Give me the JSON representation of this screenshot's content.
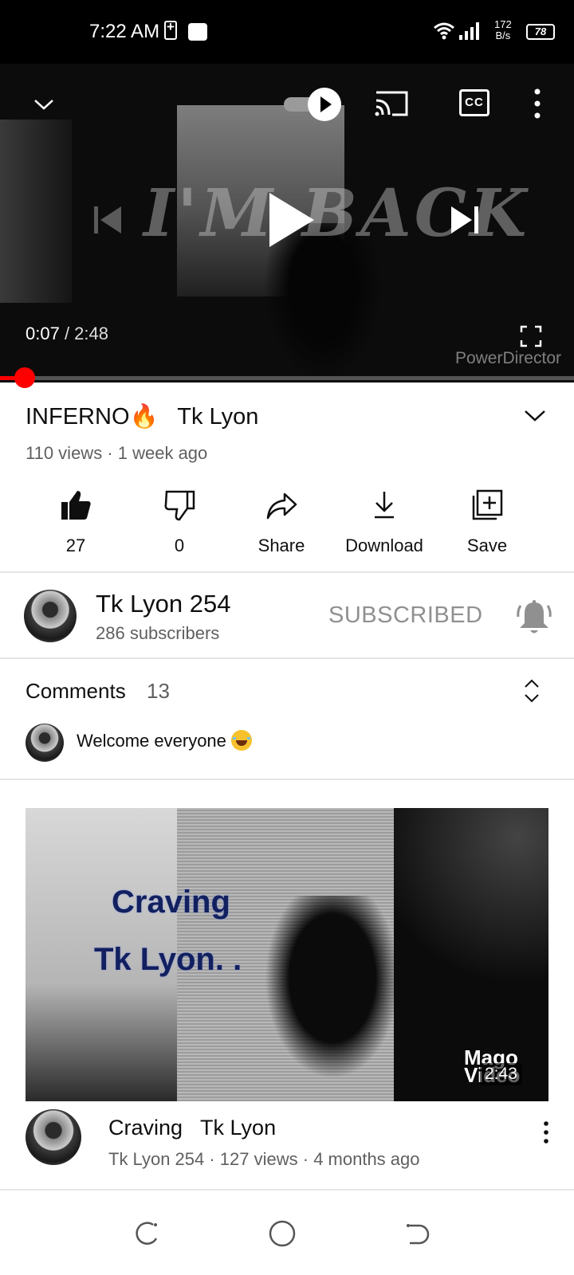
{
  "status_bar": {
    "time": "7:22 AM",
    "net_speed_value": "172",
    "net_speed_unit": "B/s",
    "battery": "78"
  },
  "player": {
    "overlay_text": "I'M BACK",
    "current_time": "0:07",
    "separator": " / ",
    "duration": "2:48",
    "watermark": "PowerDirector",
    "cc_label": "CC",
    "progress": 0.04
  },
  "video": {
    "title": "INFERNO🔥   Tk Lyon",
    "meta": "110 views · 1 week ago"
  },
  "actions": [
    {
      "name": "like",
      "label": "27"
    },
    {
      "name": "dislike",
      "label": "0"
    },
    {
      "name": "share",
      "label": "Share"
    },
    {
      "name": "download",
      "label": "Download"
    },
    {
      "name": "save",
      "label": "Save"
    }
  ],
  "channel": {
    "name": "Tk Lyon 254",
    "subscribers": "286 subscribers",
    "subscribe_state": "SUBSCRIBED"
  },
  "comments": {
    "label": "Comments",
    "count": "13",
    "top_comment": "Welcome everyone"
  },
  "next_video": {
    "thumb_line1": "Craving",
    "thumb_line2": "Tk Lyon. .",
    "thumb_logo": "Mago Video",
    "duration": "2:43",
    "title": "Craving   Tk Lyon",
    "meta": "Tk Lyon 254 · 127 views · 4 months ago"
  },
  "colors": {
    "accent_red": "#ff0000",
    "text_primary": "#0f0f0f",
    "text_secondary": "#606060"
  }
}
